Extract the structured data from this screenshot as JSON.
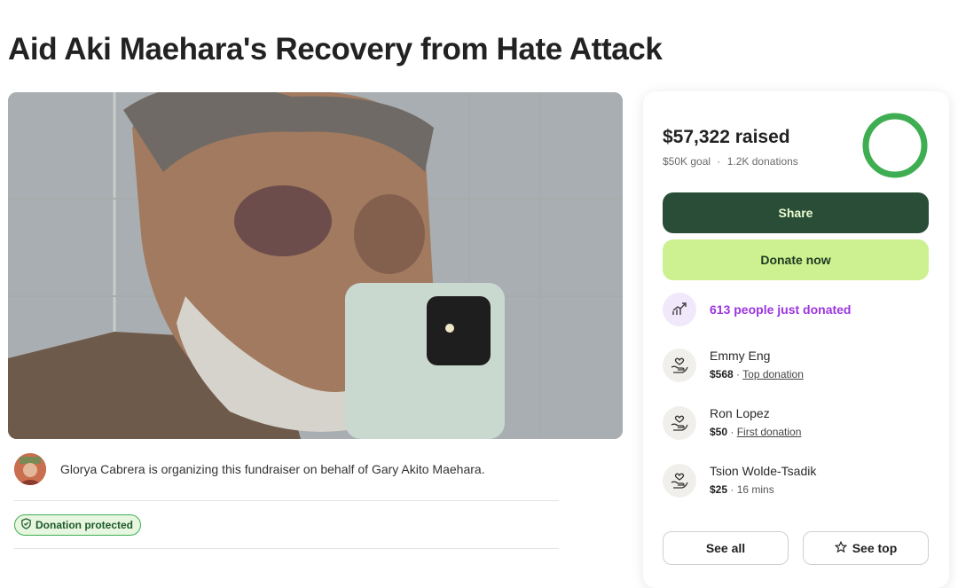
{
  "page": {
    "title": "Aid Aki Maehara's Recovery from Hate Attack"
  },
  "organizer": {
    "text": "Glorya Cabrera is organizing this fundraiser on behalf of Gary Akito Maehara."
  },
  "badge": {
    "label": "Donation protected"
  },
  "summary": {
    "raised": "$57,322 raised",
    "goal": "$50K goal",
    "separator": "·",
    "donations": "1.2K donations",
    "progress_fraction": 1.0
  },
  "buttons": {
    "share": "Share",
    "donate": "Donate now",
    "see_all": "See all",
    "see_top": "See top"
  },
  "trend": {
    "text": "613 people just donated"
  },
  "donors": [
    {
      "name": "Emmy Eng",
      "amount": "$568",
      "sep": " · ",
      "note": "Top donation"
    },
    {
      "name": "Ron Lopez",
      "amount": "$50",
      "sep": " · ",
      "note": "First donation"
    },
    {
      "name": "Tsion Wolde-Tsadik",
      "amount": "$25",
      "sep": " · ",
      "note": "16 mins"
    }
  ],
  "colors": {
    "share_bg": "#2a4d37",
    "donate_bg": "#cdf190",
    "trend_text": "#9b35e0",
    "progress": "#3fae52"
  },
  "icons": {
    "trend": "trend-up-icon",
    "donor": "hands-heart-icon",
    "star": "star-icon",
    "shield": "shield-check-icon"
  }
}
